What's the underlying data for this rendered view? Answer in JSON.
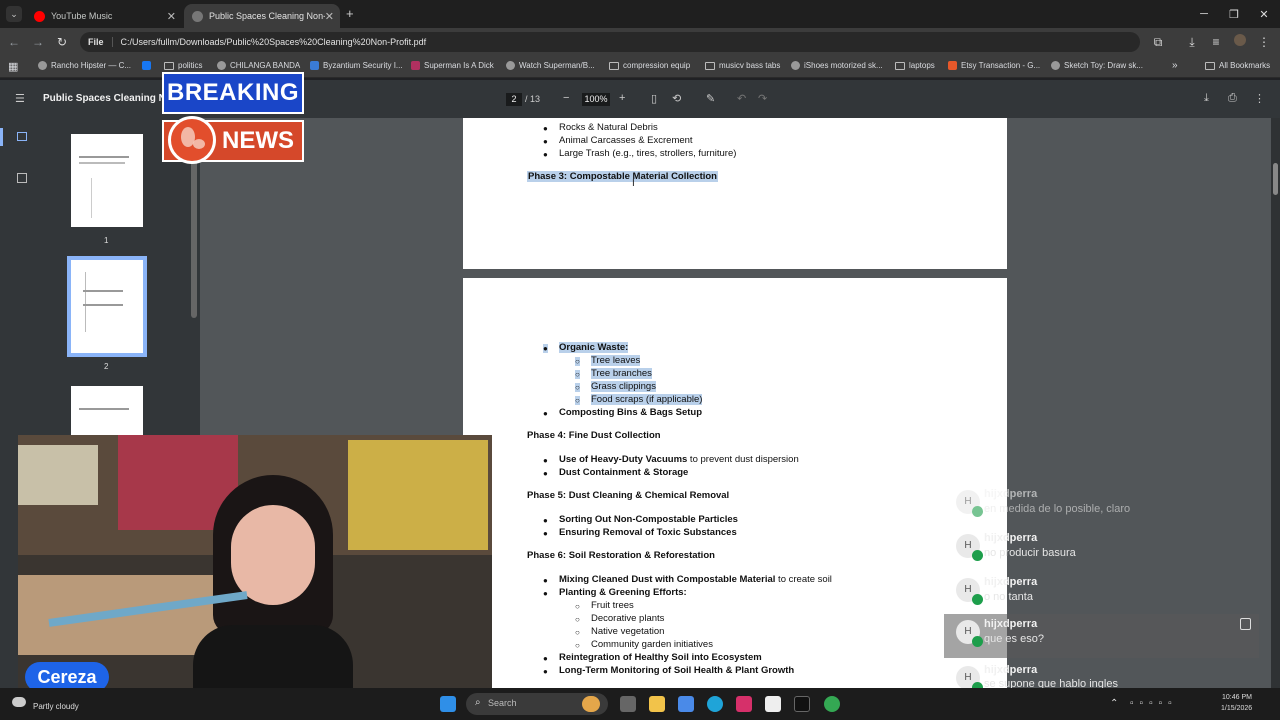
{
  "browser": {
    "tabs": [
      {
        "label": "YouTube Music"
      },
      {
        "label": "Public Spaces Cleaning Non-Pr"
      }
    ],
    "new_tab": "+",
    "omnibox": {
      "chip": "File",
      "url": "C:/Users/fullm/Downloads/Public%20Spaces%20Cleaning%20Non-Profit.pdf"
    },
    "bookmarks": [
      "Rancho Hipster — C...",
      "politics",
      "CHILANGA BANDA",
      "Byzantium Security I...",
      "Superman Is A Dick",
      "Watch Superman/B...",
      "compression equip",
      "musicv bass tabs",
      "iShoes motorized sk...",
      "laptops",
      "Etsy Transaction - G...",
      "Sketch Toy: Draw sk..."
    ],
    "all_bookmarks": "All Bookmarks"
  },
  "pdf": {
    "title": "Public Spaces Cleaning Non-",
    "page_current": "2",
    "page_total": "/ 13",
    "zoom": "100%",
    "thumb_labels": [
      "1",
      "2"
    ],
    "page1_bullets": [
      "Rocks & Natural Debris",
      "Animal Carcasses & Excrement",
      "Large Trash (e.g., tires, strollers, furniture)"
    ],
    "phase3": "Phase 3: Compostable Material Collection",
    "organic_waste": "Organic Waste:",
    "organic_items": [
      "Tree leaves",
      "Tree branches",
      "Grass clippings",
      "Food scraps (if applicable)"
    ],
    "composting": "Composting Bins & Bags Setup",
    "phase4": "Phase 4: Fine Dust Collection",
    "p4_b1_bold": "Use of Heavy-Duty Vacuums",
    "p4_b1_rest": " to prevent dust dispersion",
    "p4_b2": "Dust Containment & Storage",
    "phase5": "Phase 5: Dust Cleaning & Chemical Removal",
    "p5_b1": "Sorting Out Non-Compostable Particles",
    "p5_b2": "Ensuring Removal of Toxic Substances",
    "phase6": "Phase 6: Soil Restoration & Reforestation",
    "p6_b1_bold": "Mixing Cleaned Dust with Compostable Material",
    "p6_b1_rest": " to create soil",
    "p6_b2": "Planting & Greening Efforts:",
    "p6_sub": [
      "Fruit trees",
      "Decorative plants",
      "Native vegetation",
      "Community garden initiatives"
    ],
    "p6_b3": "Reintegration of Healthy Soil into Ecosystem",
    "p6_b4": "Long-Term Monitoring of Soil Health & Plant Growth"
  },
  "overlay": {
    "breaking": "BREAKING",
    "news": "NEWS",
    "streamer": "Cereza"
  },
  "chat": [
    {
      "avatar": "H",
      "name": "hijxdperra",
      "text": "en medida de lo posible, claro"
    },
    {
      "avatar": "H",
      "name": "hijxdperra",
      "text": "no producir basura"
    },
    {
      "avatar": "H",
      "name": "hijxdperra",
      "text": "o no tanta"
    },
    {
      "avatar": "H",
      "name": "hijxdperra",
      "text": "que es eso?"
    },
    {
      "avatar": "H",
      "name": "hijxdperra",
      "text": "se supone que hablo ingles"
    }
  ],
  "taskbar": {
    "weather": "Partly cloudy",
    "search_placeholder": "Search",
    "time": "10:46 PM",
    "date": "1/15/2026"
  }
}
